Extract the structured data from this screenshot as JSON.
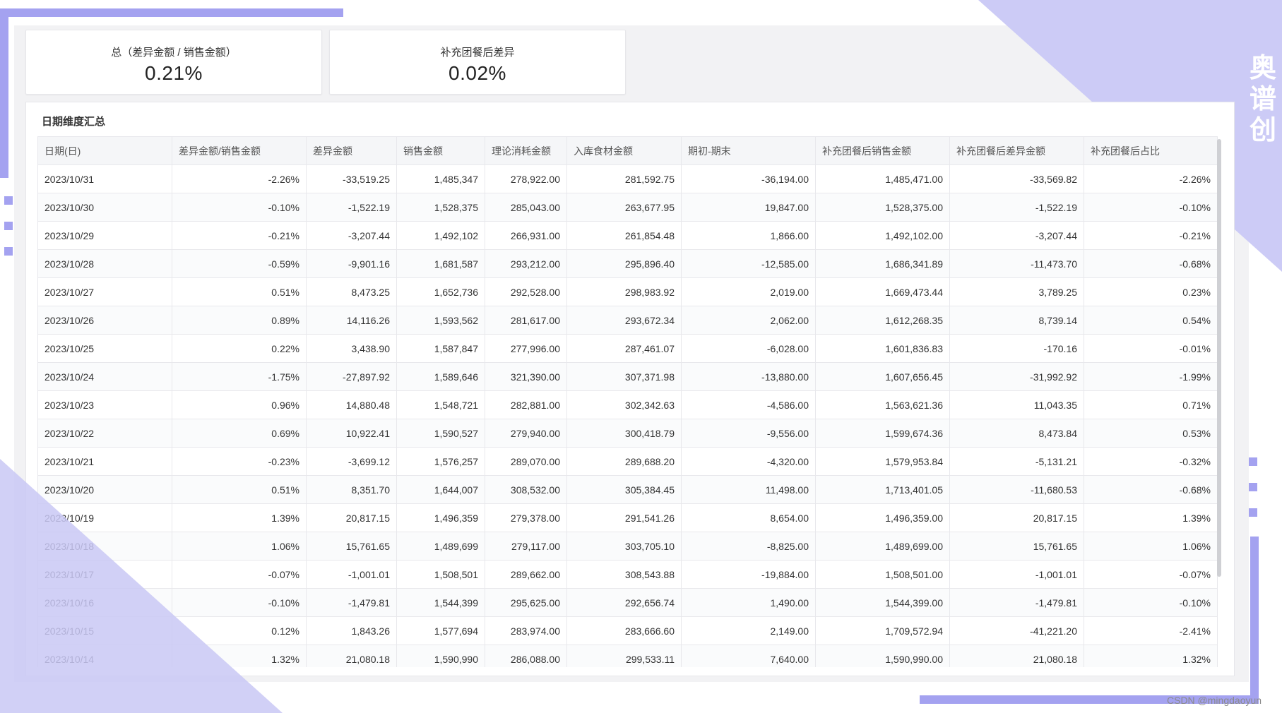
{
  "brand": "奥谱创",
  "watermark": "CSDN @mingdaoyun",
  "kpis": [
    {
      "label": "总（差异金额 / 销售金额）",
      "value": "0.21%"
    },
    {
      "label": "补充团餐后差异",
      "value": "0.02%"
    }
  ],
  "table": {
    "title": "日期维度汇总",
    "columns": [
      "日期(日)",
      "差异金额/销售金额",
      "差异金额",
      "销售金额",
      "理论消耗金额",
      "入库食材金额",
      "期初-期末",
      "补充团餐后销售金额",
      "补充团餐后差异金额",
      "补充团餐后占比"
    ],
    "rows": [
      [
        "2023/10/31",
        "-2.26%",
        "-33,519.25",
        "1,485,347",
        "278,922.00",
        "281,592.75",
        "-36,194.00",
        "1,485,471.00",
        "-33,569.82",
        "-2.26%"
      ],
      [
        "2023/10/30",
        "-0.10%",
        "-1,522.19",
        "1,528,375",
        "285,043.00",
        "263,677.95",
        "19,847.00",
        "1,528,375.00",
        "-1,522.19",
        "-0.10%"
      ],
      [
        "2023/10/29",
        "-0.21%",
        "-3,207.44",
        "1,492,102",
        "266,931.00",
        "261,854.48",
        "1,866.00",
        "1,492,102.00",
        "-3,207.44",
        "-0.21%"
      ],
      [
        "2023/10/28",
        "-0.59%",
        "-9,901.16",
        "1,681,587",
        "293,212.00",
        "295,896.40",
        "-12,585.00",
        "1,686,341.89",
        "-11,473.70",
        "-0.68%"
      ],
      [
        "2023/10/27",
        "0.51%",
        "8,473.25",
        "1,652,736",
        "292,528.00",
        "298,983.92",
        "2,019.00",
        "1,669,473.44",
        "3,789.25",
        "0.23%"
      ],
      [
        "2023/10/26",
        "0.89%",
        "14,116.26",
        "1,593,562",
        "281,617.00",
        "293,672.34",
        "2,062.00",
        "1,612,268.35",
        "8,739.14",
        "0.54%"
      ],
      [
        "2023/10/25",
        "0.22%",
        "3,438.90",
        "1,587,847",
        "277,996.00",
        "287,461.07",
        "-6,028.00",
        "1,601,836.83",
        "-170.16",
        "-0.01%"
      ],
      [
        "2023/10/24",
        "-1.75%",
        "-27,897.92",
        "1,589,646",
        "321,390.00",
        "307,371.98",
        "-13,880.00",
        "1,607,656.45",
        "-31,992.92",
        "-1.99%"
      ],
      [
        "2023/10/23",
        "0.96%",
        "14,880.48",
        "1,548,721",
        "282,881.00",
        "302,342.63",
        "-4,586.00",
        "1,563,621.36",
        "11,043.35",
        "0.71%"
      ],
      [
        "2023/10/22",
        "0.69%",
        "10,922.41",
        "1,590,527",
        "279,940.00",
        "300,418.79",
        "-9,556.00",
        "1,599,674.36",
        "8,473.84",
        "0.53%"
      ],
      [
        "2023/10/21",
        "-0.23%",
        "-3,699.12",
        "1,576,257",
        "289,070.00",
        "289,688.20",
        "-4,320.00",
        "1,579,953.84",
        "-5,131.21",
        "-0.32%"
      ],
      [
        "2023/10/20",
        "0.51%",
        "8,351.70",
        "1,644,007",
        "308,532.00",
        "305,384.45",
        "11,498.00",
        "1,713,401.05",
        "-11,680.53",
        "-0.68%"
      ],
      [
        "2023/10/19",
        "1.39%",
        "20,817.15",
        "1,496,359",
        "279,378.00",
        "291,541.26",
        "8,654.00",
        "1,496,359.00",
        "20,817.15",
        "1.39%"
      ],
      [
        "2023/10/18",
        "1.06%",
        "15,761.65",
        "1,489,699",
        "279,117.00",
        "303,705.10",
        "-8,825.00",
        "1,489,699.00",
        "15,761.65",
        "1.06%"
      ],
      [
        "2023/10/17",
        "-0.07%",
        "-1,001.01",
        "1,508,501",
        "289,662.00",
        "308,543.88",
        "-19,884.00",
        "1,508,501.00",
        "-1,001.01",
        "-0.07%"
      ],
      [
        "2023/10/16",
        "-0.10%",
        "-1,479.81",
        "1,544,399",
        "295,625.00",
        "292,656.74",
        "1,490.00",
        "1,544,399.00",
        "-1,479.81",
        "-0.10%"
      ],
      [
        "2023/10/15",
        "0.12%",
        "1,843.26",
        "1,577,694",
        "283,974.00",
        "283,666.60",
        "2,149.00",
        "1,709,572.94",
        "-41,221.20",
        "-2.41%"
      ],
      [
        "2023/10/14",
        "1.32%",
        "21,080.18",
        "1,590,990",
        "286,088.00",
        "299,533.11",
        "7,640.00",
        "1,590,990.00",
        "21,080.18",
        "1.32%"
      ]
    ]
  }
}
